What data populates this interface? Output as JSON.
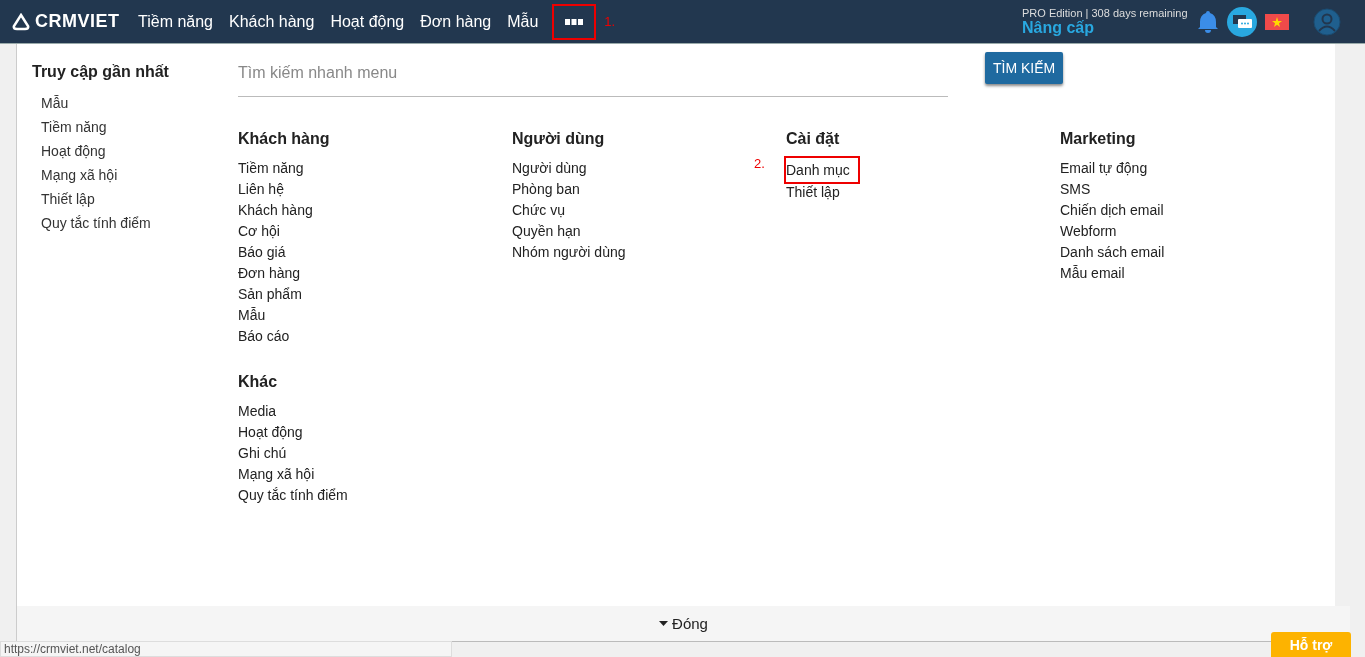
{
  "navbar": {
    "logo": "CRMVIET",
    "items": [
      "Tiềm năng",
      "Khách hàng",
      "Hoạt động",
      "Đơn hàng",
      "Mẫu"
    ],
    "more_annotation": "1.",
    "edition": "PRO Edition | 308 days remaining",
    "upgrade": "Nâng cấp"
  },
  "mega_menu": {
    "recent_title": "Truy cập gần nhất",
    "recent_items": [
      "Mẫu",
      "Tiềm năng",
      "Hoạt động",
      "Mạng xã hội",
      "Thiết lập",
      "Quy tắc tính điểm"
    ],
    "search": {
      "placeholder": "Tìm kiếm nhanh menu"
    },
    "search_button": "TÌM KIẾM",
    "columns": [
      [
        {
          "title": "Khách hàng",
          "items": [
            {
              "label": "Tiềm năng"
            },
            {
              "label": "Liên hệ"
            },
            {
              "label": "Khách hàng"
            },
            {
              "label": "Cơ hội"
            },
            {
              "label": "Báo giá"
            },
            {
              "label": "Đơn hàng"
            },
            {
              "label": "Sản phẩm"
            },
            {
              "label": "Mẫu"
            },
            {
              "label": "Báo cáo"
            }
          ]
        },
        {
          "title": "Khác",
          "items": [
            {
              "label": "Media"
            },
            {
              "label": "Hoạt động"
            },
            {
              "label": "Ghi chú"
            },
            {
              "label": "Mạng xã hội"
            },
            {
              "label": "Quy tắc tính điểm"
            }
          ]
        }
      ],
      [
        {
          "title": "Người dùng",
          "items": [
            {
              "label": "Người dùng"
            },
            {
              "label": "Phòng ban"
            },
            {
              "label": "Chức vụ"
            },
            {
              "label": "Quyền hạn"
            },
            {
              "label": "Nhóm người dùng"
            }
          ]
        }
      ],
      [
        {
          "title": "Cài đặt",
          "items": [
            {
              "label": "Danh mục",
              "annotation": "2."
            },
            {
              "label": "Thiết lập"
            }
          ]
        }
      ],
      [
        {
          "title": "Marketing",
          "items": [
            {
              "label": "Email tự động"
            },
            {
              "label": "SMS"
            },
            {
              "label": "Chiến dịch email"
            },
            {
              "label": "Webform"
            },
            {
              "label": "Danh sách email"
            },
            {
              "label": "Mẫu email"
            }
          ]
        }
      ]
    ],
    "close_label": "Đóng"
  },
  "status_url": "https://crmviet.net/catalog",
  "support_button": "Hỗ trợ"
}
